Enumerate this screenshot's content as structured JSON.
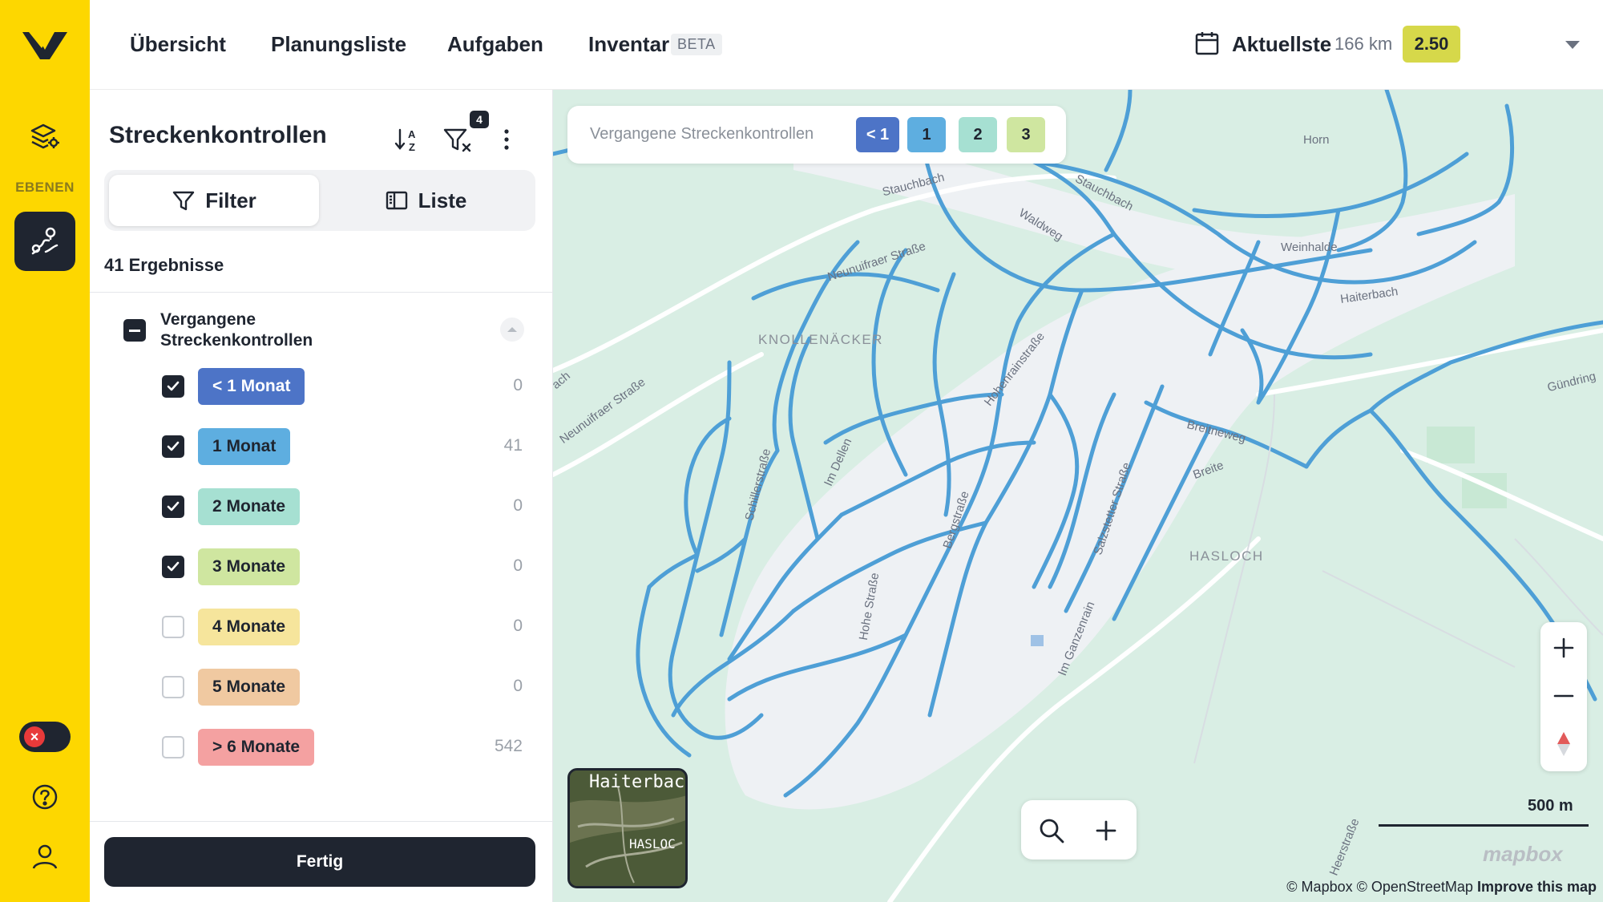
{
  "rail": {
    "section_label": "EBENEN",
    "colors": {
      "background": "#fdd700",
      "active": "#1f2530"
    },
    "icons": [
      "logo-icon",
      "layers-settings-icon",
      "route-icon",
      "close-icon",
      "help-icon",
      "user-icon"
    ]
  },
  "nav": {
    "items": [
      "Übersicht",
      "Planungsliste",
      "Aufgaben",
      "Inventar"
    ],
    "beta": "BETA",
    "latest_label": "Aktuellste",
    "distance": "166 km",
    "score": "2.50"
  },
  "panel": {
    "title": "Streckenkontrollen",
    "filter_count": "4",
    "tabs": {
      "filter": "Filter",
      "list": "Liste"
    },
    "results": "41 Ergebnisse",
    "group_title": "Vergangene Streckenkontrollen",
    "rows": [
      {
        "label": "< 1 Monat",
        "count": "0",
        "checked": true,
        "color": "#4d74c7",
        "text_color": "#ffffff"
      },
      {
        "label": "1 Monat",
        "count": "41",
        "checked": true,
        "color": "#5eaee0",
        "text_color": "#1f2530"
      },
      {
        "label": "2 Monate",
        "count": "0",
        "checked": true,
        "color": "#a6e0d2",
        "text_color": "#1f2530"
      },
      {
        "label": "3 Monate",
        "count": "0",
        "checked": true,
        "color": "#cfe6a0",
        "text_color": "#1f2530"
      },
      {
        "label": "4 Monate",
        "count": "0",
        "checked": false,
        "color": "#f6e59c",
        "text_color": "#1f2530"
      },
      {
        "label": "5 Monate",
        "count": "0",
        "checked": false,
        "color": "#f0c9a1",
        "text_color": "#1f2530"
      },
      {
        "label": "> 6 Monate",
        "count": "542",
        "checked": false,
        "color": "#f4a1a1",
        "text_color": "#1f2530"
      }
    ],
    "done_label": "Fertig"
  },
  "map": {
    "legend_title": "Vergangene Streckenkontrollen",
    "legend_chips": [
      {
        "label": "< 1",
        "color": "#4d74c7",
        "text_color": "#ffffff"
      },
      {
        "label": "1",
        "color": "#5eaee0",
        "text_color": "#1f2530"
      },
      {
        "label": "2",
        "color": "#a6e0d2",
        "text_color": "#1f2530"
      },
      {
        "label": "3",
        "color": "#cfe6a0",
        "text_color": "#1f2530"
      }
    ],
    "labels": {
      "horn": "Horn",
      "stauchbach1": "Stauchbach",
      "stauchbach2": "Stauchbach",
      "waldweg": "Waldweg",
      "weinhalde": "Weinhalde",
      "haiterbach": "Haiterbach",
      "neunuifraer1": "Neunuifraer Straße",
      "neunuifraer2": "Neunuifraer Straße",
      "ach": "ach",
      "knollenacker": "KNOLLENÄCKER",
      "hohenrain": "Hohenrainstraße",
      "breitneweg": "Breitneweg",
      "breite": "Breite",
      "gundring": "Gündring",
      "hasloch": "HASLOCH",
      "schiller": "Schillerstraße",
      "imdellen": "Im Dellen",
      "bergstrasse": "Bergstraße",
      "salzstetter": "Salzstetter Straße",
      "hohestrasse": "Hohe Straße",
      "imganzenrain": "Im Ganzenrain",
      "heerstrasse": "Heerstraße"
    },
    "minimap_label": "Haiterbach",
    "minimap_label2": "HASLOC",
    "scale": "500 m",
    "brand": "mapbox",
    "attribution": "© Mapbox © OpenStreetMap",
    "improve": "Improve this map",
    "route_color": "#4e9fd6"
  }
}
